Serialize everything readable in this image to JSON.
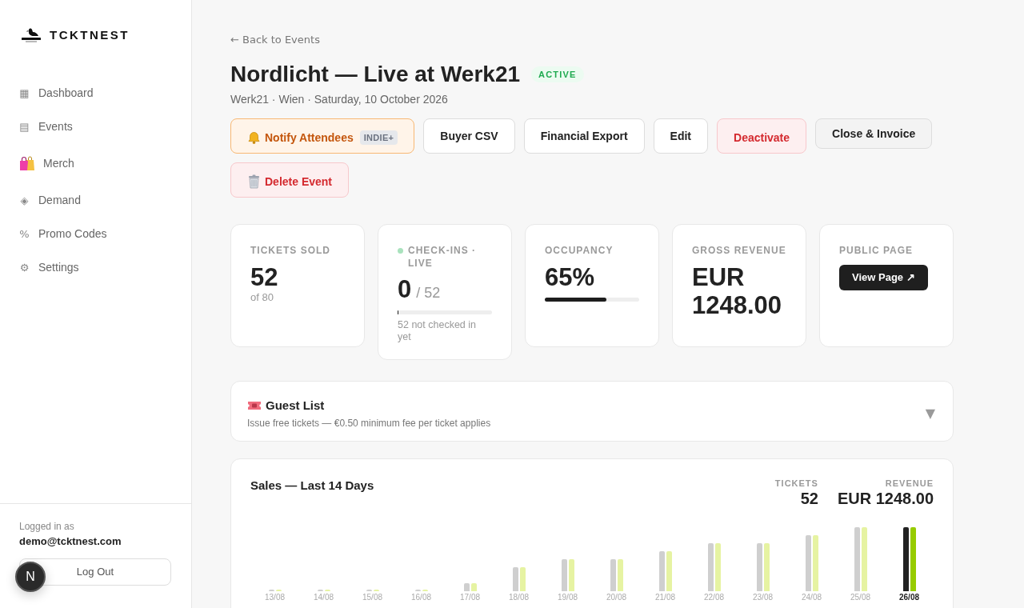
{
  "sidebar": {
    "brand": "TCKTNEST",
    "items": [
      {
        "glyph": "▦",
        "label": "Dashboard",
        "selected": false
      },
      {
        "glyph": "▤",
        "label": "Events",
        "selected": false
      },
      {
        "label": "Merch",
        "selected": false
      },
      {
        "glyph": "◈",
        "label": "Demand",
        "selected": false
      },
      {
        "glyph": "%",
        "label": "Promo Codes",
        "selected": false
      },
      {
        "glyph": "⚙",
        "label": "Settings",
        "selected": false
      }
    ],
    "account": {
      "caption": "Logged in as",
      "email": "demo@tcktnest.com",
      "logout": "Log Out"
    }
  },
  "back_link": "← Back to Events",
  "event": {
    "title": "Nordlicht — Live at Werk21",
    "status": {
      "label": "ACTIVE",
      "kind": "active"
    },
    "subtitle": "Werk21 · Wien · Saturday, 10 October 2026"
  },
  "actions": [
    {
      "label": "Notify Attendees",
      "kind": "notify",
      "tag": "INDIE+"
    },
    {
      "label": "Buyer CSV",
      "kind": "plain"
    },
    {
      "label": "Financial Export",
      "kind": "plain"
    },
    {
      "label": "Edit",
      "kind": "plain"
    },
    {
      "label": "Deactivate",
      "kind": "danger"
    },
    {
      "label": "Close & Invoice",
      "kind": "muted"
    },
    {
      "label": "Delete Event",
      "kind": "delete"
    }
  ],
  "stats": [
    {
      "kind": "count",
      "label": "TICKETS SOLD",
      "value": "52",
      "note": "of 80"
    },
    {
      "kind": "checkins",
      "label": "CHECK-INS · LIVE",
      "live": true,
      "value": "0",
      "total": "/ 52",
      "level": 0,
      "note": "52 not checked in yet"
    },
    {
      "kind": "meter",
      "label": "OCCUPANCY",
      "value": "65%",
      "level": 0.65
    },
    {
      "kind": "amount",
      "label": "GROSS REVENUE",
      "value": "EUR 1248.00"
    },
    {
      "kind": "link",
      "label": "PUBLIC PAGE",
      "button": "View Page ↗"
    }
  ],
  "guest_list": {
    "title": "Guest List",
    "description": "Issue free tickets — €0.50 minimum fee per ticket applies",
    "toggle": "▼"
  },
  "sales": {
    "title": "Sales — Last 14 Days",
    "totals": [
      {
        "label": "TICKETS",
        "value": "52"
      },
      {
        "label": "REVENUE",
        "value": "EUR 1248.00"
      }
    ],
    "days": [
      {
        "label": "13/08",
        "selected": false
      },
      {
        "label": "14/08",
        "selected": false
      },
      {
        "label": "15/08",
        "selected": false
      },
      {
        "label": "16/08",
        "selected": false
      },
      {
        "label": "17/08",
        "selected": false
      },
      {
        "label": "18/08",
        "selected": false
      },
      {
        "label": "19/08",
        "selected": false
      },
      {
        "label": "20/08",
        "selected": false
      },
      {
        "label": "21/08",
        "selected": false
      },
      {
        "label": "22/08",
        "selected": false
      },
      {
        "label": "23/08",
        "selected": false
      },
      {
        "label": "24/08",
        "selected": false
      },
      {
        "label": "25/08",
        "selected": false
      },
      {
        "label": "26/08",
        "selected": true
      }
    ]
  },
  "dev_badge": {
    "label": "N"
  }
}
